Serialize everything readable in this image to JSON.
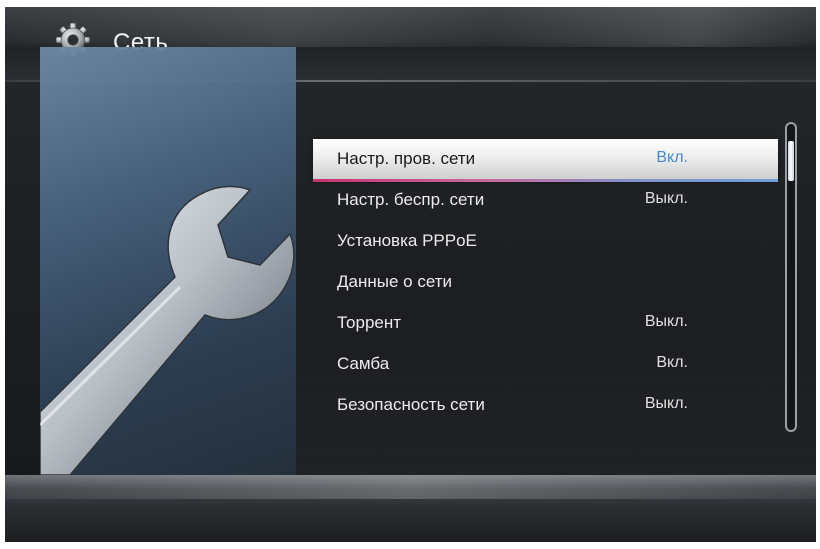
{
  "header": {
    "title": "Сеть",
    "icon": "gear-icon"
  },
  "menu": {
    "items": [
      {
        "label": "Настр. пров. сети",
        "value": "Вкл.",
        "selected": true
      },
      {
        "label": "Настр. беспр. сети",
        "value": "Выкл.",
        "selected": false
      },
      {
        "label": "Установка PPPoE",
        "value": "",
        "selected": false
      },
      {
        "label": "Данные о сети",
        "value": "",
        "selected": false
      },
      {
        "label": "Торрент",
        "value": "Выкл.",
        "selected": false
      },
      {
        "label": "Самба",
        "value": "Вкл.",
        "selected": false
      },
      {
        "label": "Безопасность сети",
        "value": "Выкл.",
        "selected": false
      }
    ]
  },
  "colors": {
    "selected_value": "#4a8ad0",
    "highlight_left": "#c8336f",
    "highlight_right": "#6fa0d8"
  },
  "decor": {
    "left_art_icon": "wrench-icon"
  }
}
